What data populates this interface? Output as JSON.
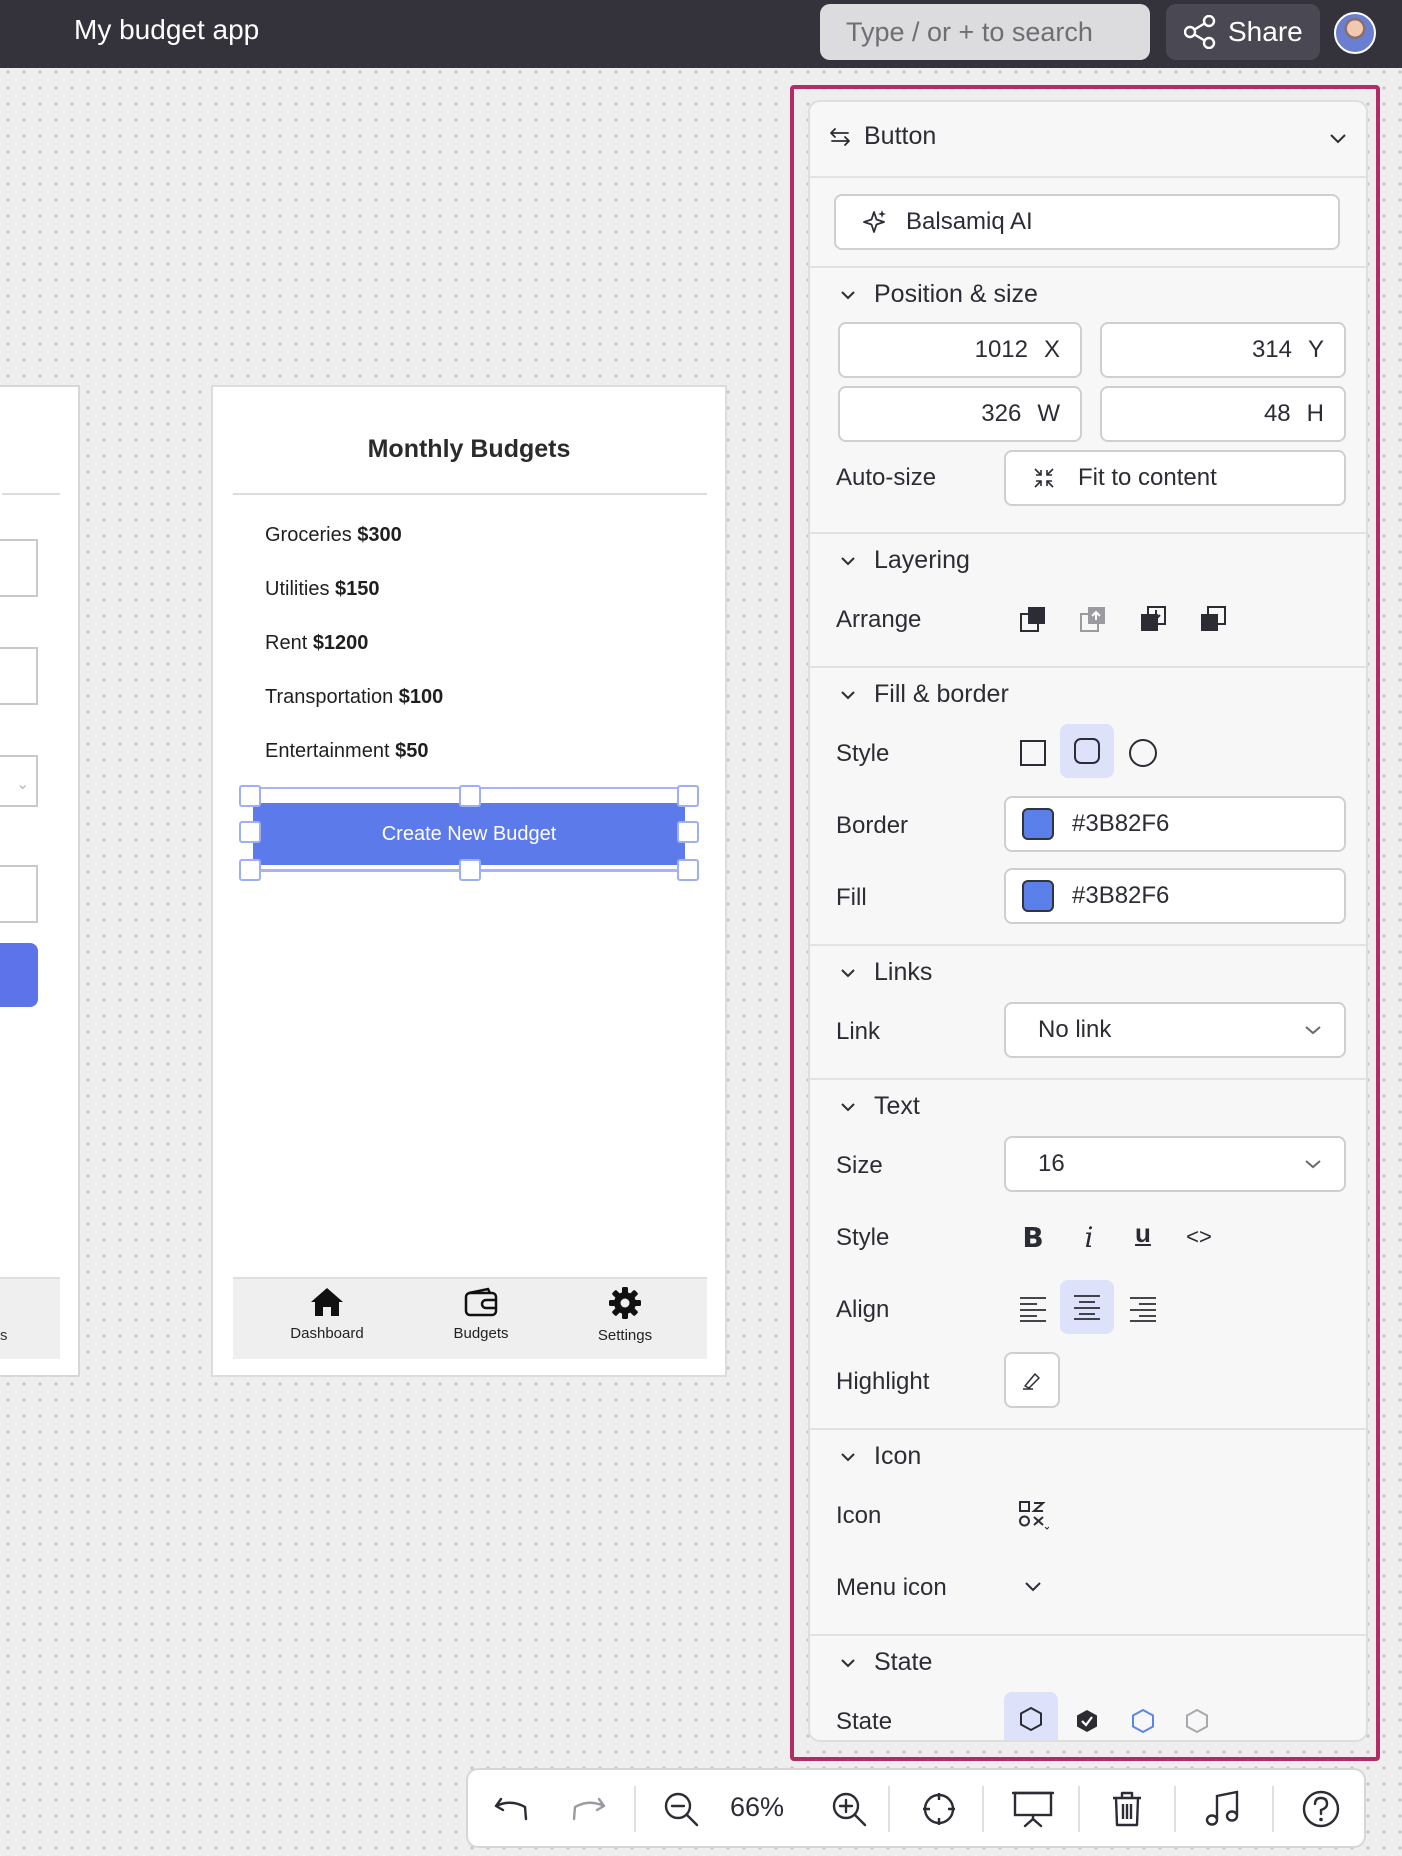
{
  "app": {
    "title": "My budget app"
  },
  "search": {
    "placeholder": "Type / or + to search"
  },
  "share": {
    "label": "Share"
  },
  "canvas": {
    "left_frame": {
      "nav_label_partial": "s"
    },
    "phone": {
      "title": "Monthly Budgets",
      "items": [
        {
          "name": "Groceries",
          "amount": "$300"
        },
        {
          "name": "Utilities",
          "amount": "$150"
        },
        {
          "name": "Rent",
          "amount": "$1200"
        },
        {
          "name": "Transportation",
          "amount": "$100"
        },
        {
          "name": "Entertainment",
          "amount": "$50"
        }
      ],
      "button_label": "Create New Budget",
      "button_color": "#5C7AE9",
      "tabs": [
        {
          "label": "Dashboard",
          "icon": "home-icon"
        },
        {
          "label": "Budgets",
          "icon": "wallet-icon"
        },
        {
          "label": "Settings",
          "icon": "gear-icon"
        }
      ]
    }
  },
  "panel": {
    "component_type": "Button",
    "ai_button": "Balsamiq AI",
    "position_size": {
      "title": "Position & size",
      "x": {
        "value": "1012",
        "label": "X"
      },
      "y": {
        "value": "314",
        "label": "Y"
      },
      "w": {
        "value": "326",
        "label": "W"
      },
      "h": {
        "value": "48",
        "label": "H"
      },
      "autosize_label": "Auto-size",
      "autosize_value": "Fit to content"
    },
    "layering": {
      "title": "Layering",
      "arrange_label": "Arrange"
    },
    "fill_border": {
      "title": "Fill & border",
      "style_label": "Style",
      "selected_style": "rounded",
      "border_label": "Border",
      "border_color": "#3B82F6",
      "fill_label": "Fill",
      "fill_color": "#3B82F6"
    },
    "links": {
      "title": "Links",
      "link_label": "Link",
      "link_value": "No link"
    },
    "text": {
      "title": "Text",
      "size_label": "Size",
      "size_value": "16",
      "style_label": "Style",
      "style_buttons": [
        "B",
        "i",
        "u",
        "<>"
      ],
      "align_label": "Align",
      "selected_align": "center",
      "highlight_label": "Highlight"
    },
    "icon": {
      "title": "Icon",
      "icon_label": "Icon",
      "menu_icon_label": "Menu icon"
    },
    "state": {
      "title": "State",
      "state_label": "State",
      "selected_state": "normal"
    }
  },
  "toolbar": {
    "zoom": "66%"
  },
  "colors": {
    "accent_outline": "#B22D63",
    "topbar": "#34333C",
    "selection": "#DDE1FA"
  }
}
